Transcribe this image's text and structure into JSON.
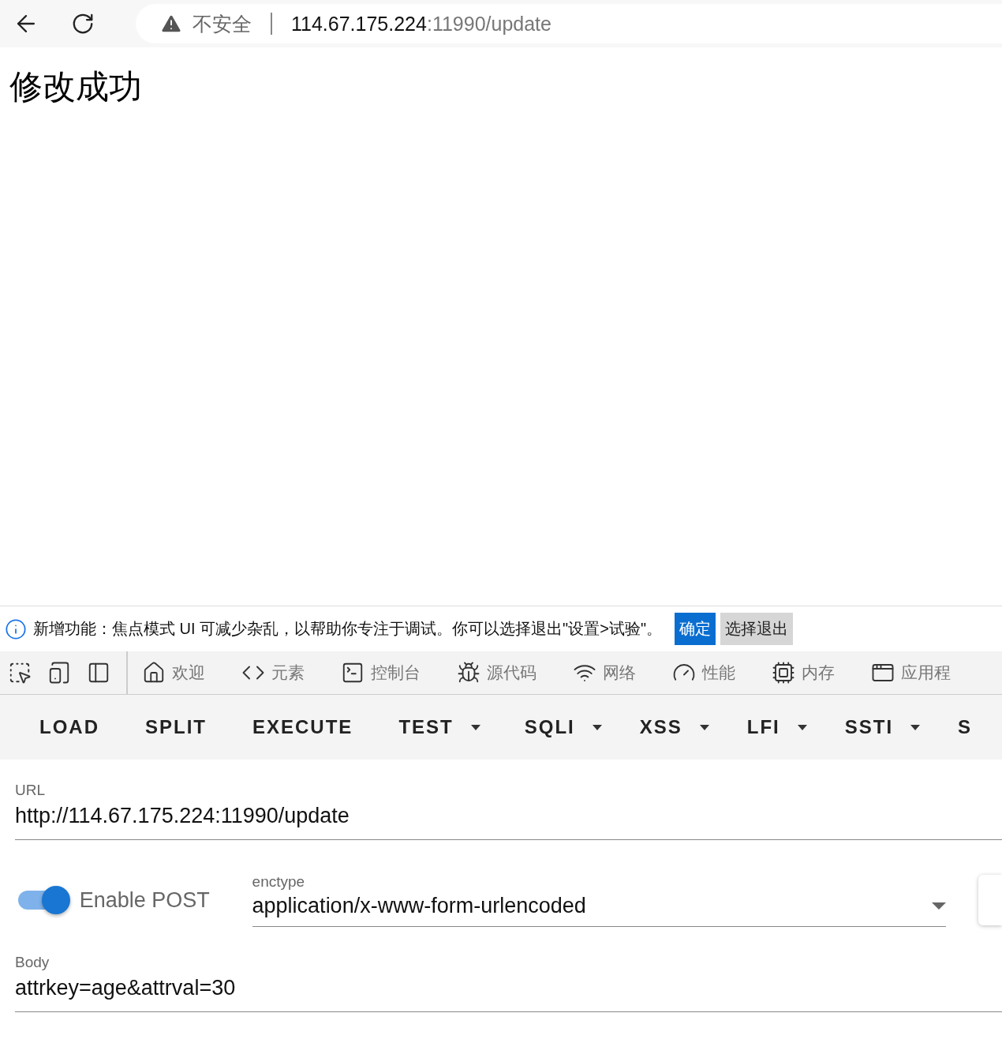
{
  "address_bar": {
    "security": "不安全",
    "host": "114.67.175.224",
    "path": ":11990/update"
  },
  "page": {
    "heading": "修改成功"
  },
  "infobar": {
    "message": "新增功能：焦点模式 UI 可减少杂乱，以帮助你专注于调试。你可以选择退出\"设置>试验\"。",
    "buttons": [
      {
        "label": "确定",
        "primary": true
      },
      {
        "label": "选择退出",
        "primary": false
      }
    ]
  },
  "devtools_tabs": [
    {
      "label": "欢迎"
    },
    {
      "label": "元素"
    },
    {
      "label": "控制台"
    },
    {
      "label": "源代码"
    },
    {
      "label": "网络"
    },
    {
      "label": "性能"
    },
    {
      "label": "内存"
    },
    {
      "label": "应用程"
    }
  ],
  "hackbar": {
    "buttons": [
      {
        "label": "LOAD",
        "dropdown": false
      },
      {
        "label": "SPLIT",
        "dropdown": false
      },
      {
        "label": "EXECUTE",
        "dropdown": false
      },
      {
        "label": "TEST",
        "dropdown": true
      },
      {
        "label": "SQLI",
        "dropdown": true
      },
      {
        "label": "XSS",
        "dropdown": true
      },
      {
        "label": "LFI",
        "dropdown": true
      },
      {
        "label": "SSTI",
        "dropdown": true
      },
      {
        "label": "S",
        "dropdown": false
      }
    ],
    "url": {
      "label": "URL",
      "value": "http://114.67.175.224:11990/update"
    },
    "post": {
      "label": "Enable POST",
      "on": true
    },
    "enctype": {
      "label": "enctype",
      "value": "application/x-www-form-urlencoded"
    },
    "body": {
      "label": "Body",
      "value": "attrkey=age&attrval=30"
    }
  }
}
